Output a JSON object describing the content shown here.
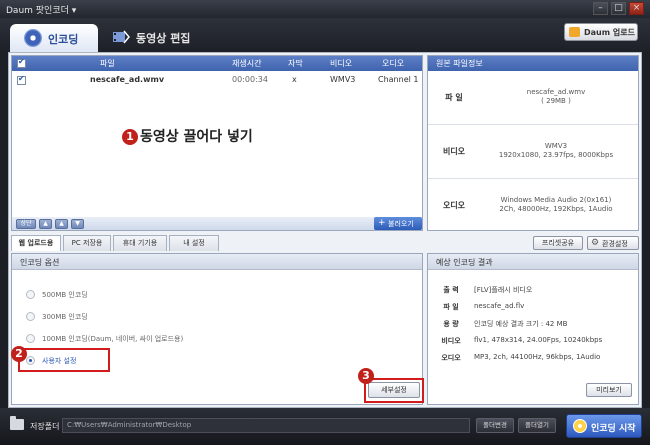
{
  "window": {
    "title": "Daum 팟인코더",
    "title_arrow": "▾",
    "minimize": "–",
    "maximize": "□",
    "close": "×"
  },
  "top_tabs": {
    "encoding": "인코딩",
    "video_edit": "동영상 편집",
    "daum_update": "Daum 업로드"
  },
  "file_list": {
    "columns": [
      "파일",
      "재생시간",
      "자막",
      "비디오",
      "오디오"
    ],
    "rows": [
      {
        "checked": true,
        "file": "nescafe_ad.wmv",
        "duration": "00:00:34",
        "subtitle": "x",
        "video": "WMV3",
        "audio": "Channel 1"
      }
    ],
    "drop_hint_number": "1",
    "drop_hint": "동영상 끌어다 넣기",
    "order_buttons": [
      "상단",
      "▲",
      "▲",
      "▼"
    ],
    "add_button": "불러오기"
  },
  "source_info": {
    "title": "원본 파일정보",
    "file_label": "파 일",
    "file_value": "nescafe_ad.wmv",
    "file_size": "( 29MB )",
    "video_label": "비디오",
    "video_codec": "WMV3",
    "video_detail": "1920x1080, 23.97fps, 8000Kbps",
    "audio_label": "오디오",
    "audio_codec": "Windows Media Audio 2(0x161)",
    "audio_detail": "2Ch, 48000Hz, 192Kbps, 1Audio"
  },
  "preset_tabs": [
    "웹 업로드용",
    "PC 저장용",
    "휴대 기기용",
    "내 설정"
  ],
  "preset_share": "프리셋공유",
  "env_settings": "환경설정",
  "encode_options": {
    "title": "인코딩 옵션",
    "options": [
      {
        "label": "500MB 인코딩",
        "selected": false
      },
      {
        "label": "300MB 인코딩",
        "selected": false
      },
      {
        "label": "100MB 인코딩(Daum, 네이버, 싸이 업로드용)",
        "selected": false
      },
      {
        "label": "사용자 설정",
        "selected": true
      }
    ],
    "option_number": "2",
    "detail_number": "3",
    "detail_button": "세부설정"
  },
  "encode_result": {
    "title": "예상 인코딩 결과",
    "rows": [
      {
        "label": "출 력",
        "value": "[FLV]플래시 비디오"
      },
      {
        "label": "파 일",
        "value": "nescafe_ad.flv"
      },
      {
        "label": "용 량",
        "value": "인코딩 예상 결과 크기 : 42 MB"
      },
      {
        "label": "비디오",
        "value": "flv1, 478x314, 24.00Fps, 10240kbps"
      },
      {
        "label": "오디오",
        "value": "MP3, 2ch, 44100Hz, 96kbps, 1Audio"
      }
    ],
    "preview_button": "미리보기"
  },
  "bottom": {
    "save_folder_label": "저장폴더",
    "path": "C:₩Users₩Administrator₩Desktop",
    "change_folder": "폴더변경",
    "open_folder": "폴더열기",
    "start_encoding": "인코딩 시작"
  }
}
